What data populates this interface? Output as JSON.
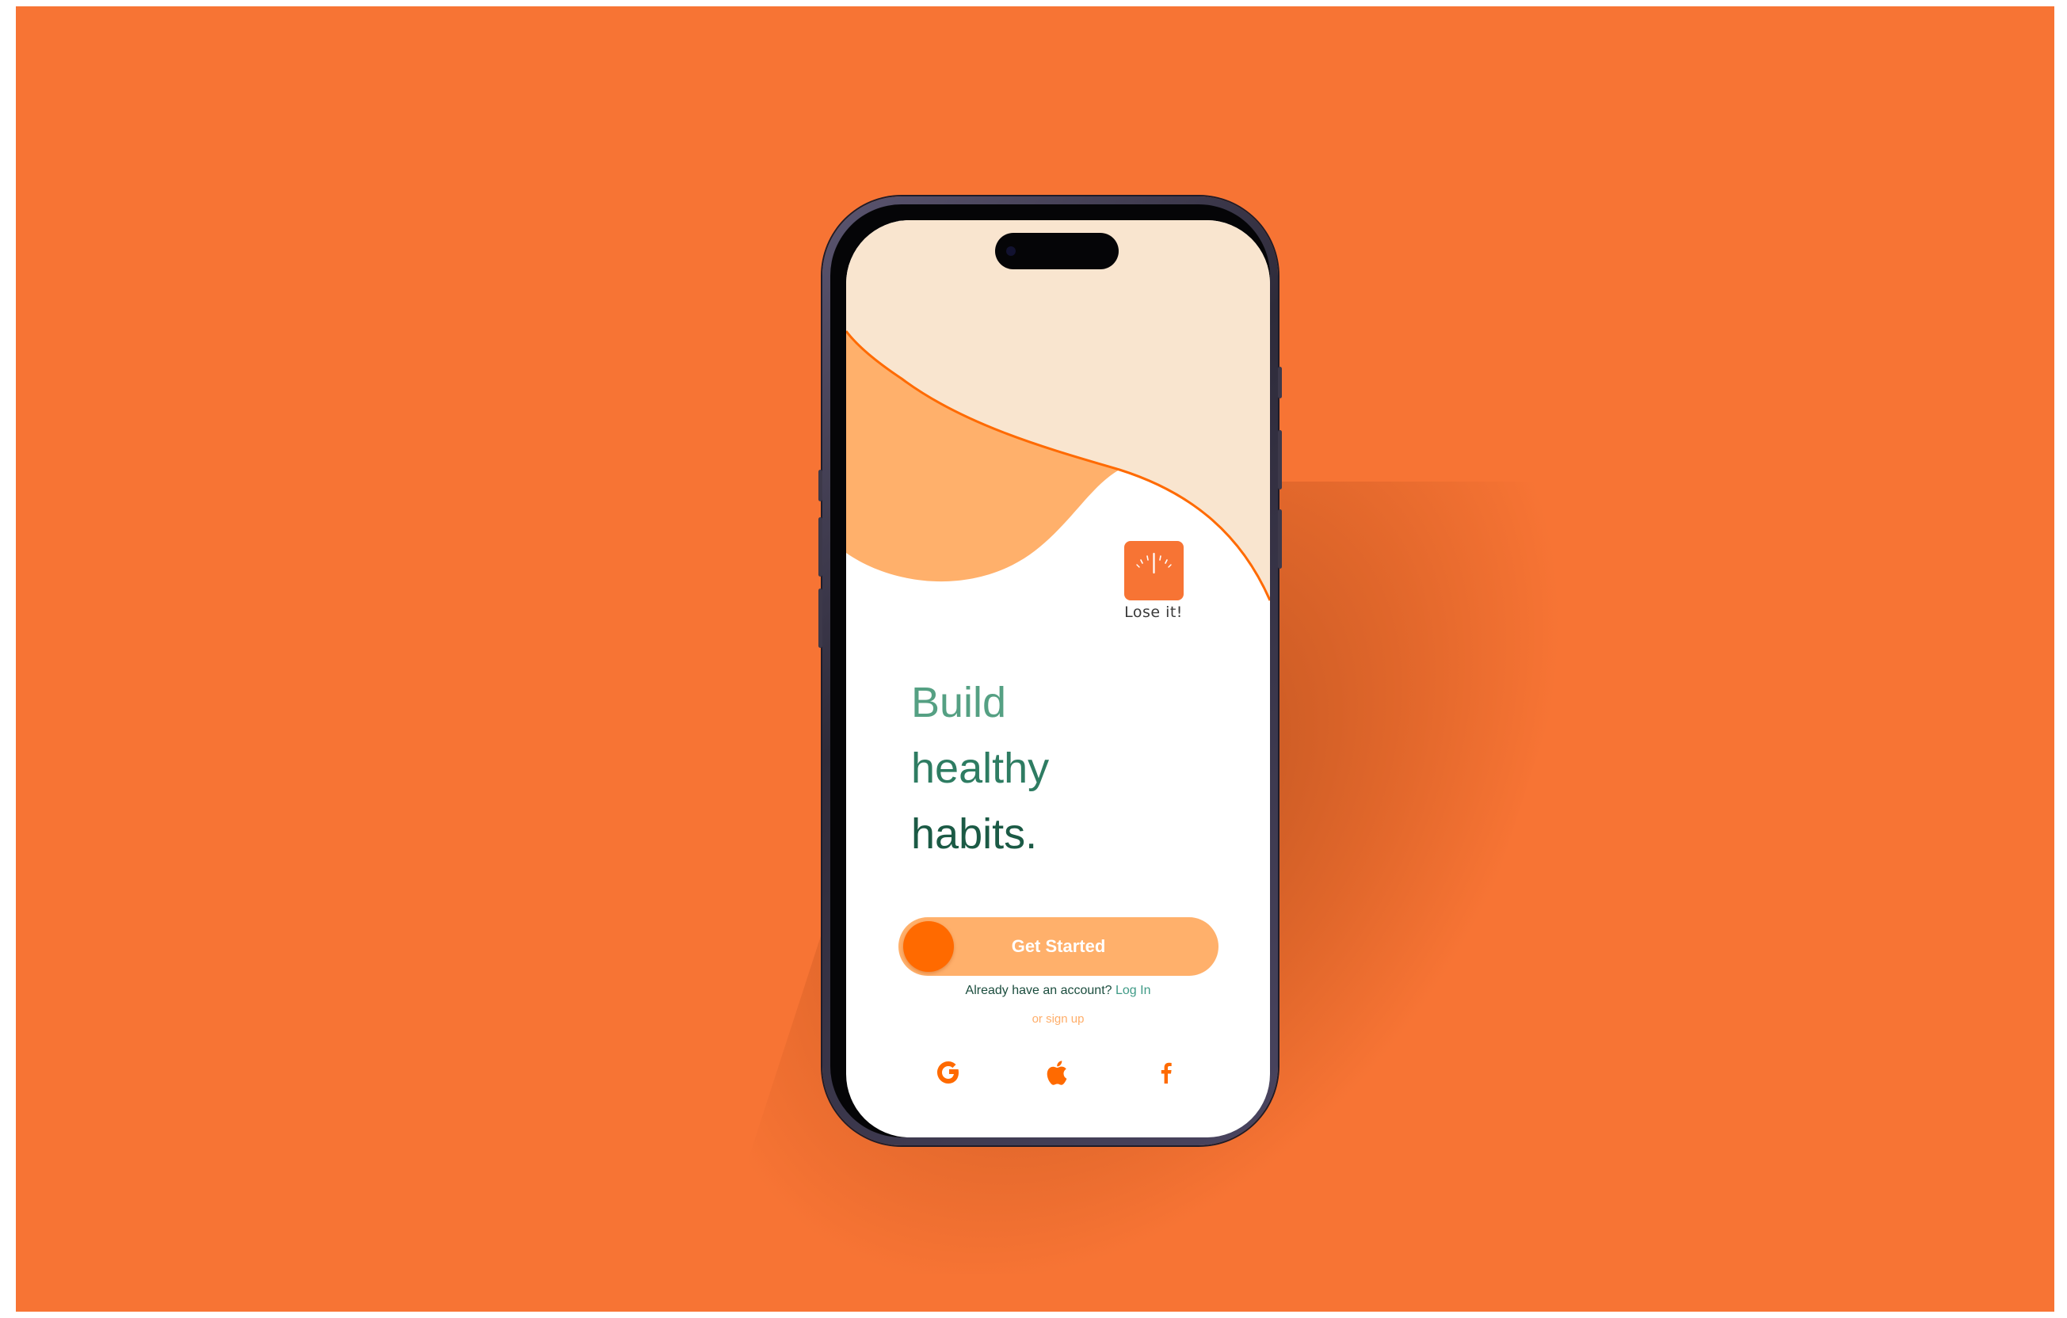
{
  "colors": {
    "background": "#f77434",
    "accent": "#ff6a00",
    "button_fill": "#ffb06b",
    "wave_light": "#f9e5cf",
    "wave_mid": "#ffb06b",
    "headline_green": "#2e7c62"
  },
  "app": {
    "logo_icon": "scale-icon",
    "logo_label": "Lose it!"
  },
  "headline": {
    "line1": "Build",
    "line2": "healthy",
    "line3": "habits."
  },
  "cta": {
    "label": "Get Started"
  },
  "account": {
    "prompt": "Already have an account?",
    "login_label": "Log In"
  },
  "signup": {
    "label": "or sign up"
  },
  "social": [
    {
      "name": "google-icon"
    },
    {
      "name": "apple-icon"
    },
    {
      "name": "facebook-icon"
    }
  ]
}
